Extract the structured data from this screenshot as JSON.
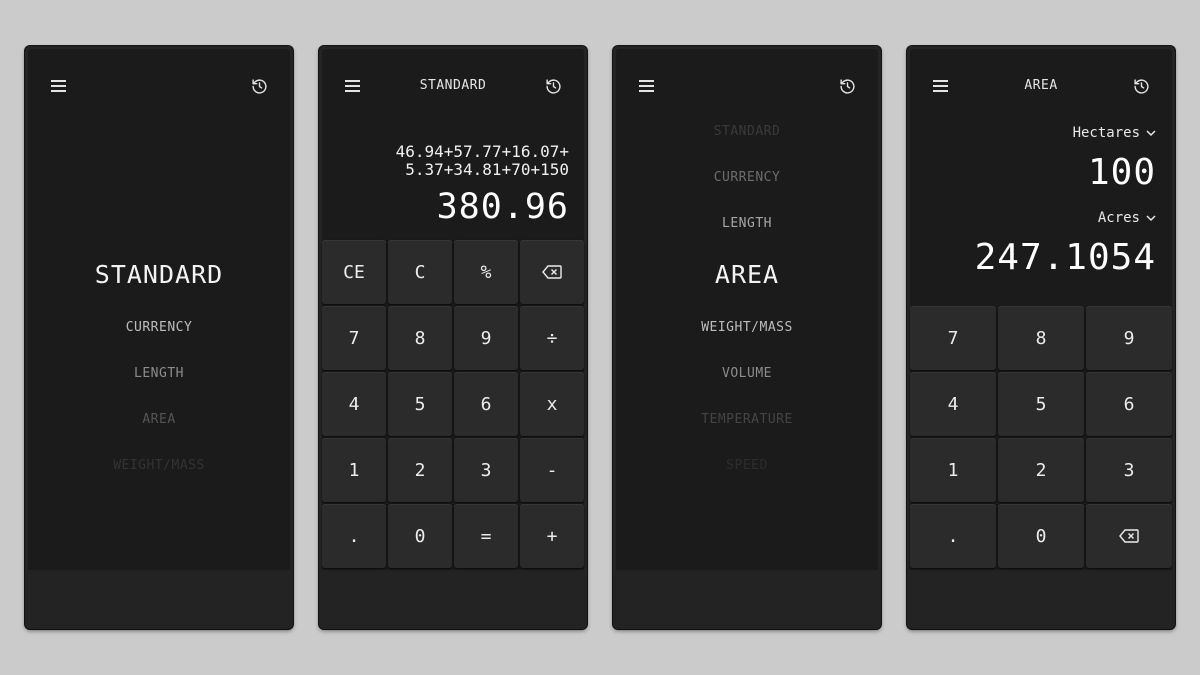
{
  "phone1": {
    "modes": [
      {
        "label": "STANDARD",
        "color": "#f3f3f3"
      },
      {
        "label": "CURRENCY",
        "color": "#bdbdbd"
      },
      {
        "label": "LENGTH",
        "color": "#8c8c8c"
      },
      {
        "label": "AREA",
        "color": "#555555"
      },
      {
        "label": "WEIGHT/MASS",
        "color": "#333333"
      }
    ]
  },
  "phone2": {
    "title": "STANDARD",
    "expression_line1": "46.94+57.77+16.07+",
    "expression_line2": "5.37+34.81+70+150",
    "result": "380.96",
    "keys": [
      {
        "label": "CE",
        "name": "clear-entry-key"
      },
      {
        "label": "C",
        "name": "clear-key"
      },
      {
        "label": "%",
        "name": "percent-key"
      },
      {
        "label": "",
        "name": "backspace-key",
        "icon": "backspace-icon"
      },
      {
        "label": "7",
        "name": "digit-7-key"
      },
      {
        "label": "8",
        "name": "digit-8-key"
      },
      {
        "label": "9",
        "name": "digit-9-key"
      },
      {
        "label": "÷",
        "name": "divide-key"
      },
      {
        "label": "4",
        "name": "digit-4-key"
      },
      {
        "label": "5",
        "name": "digit-5-key"
      },
      {
        "label": "6",
        "name": "digit-6-key"
      },
      {
        "label": "x",
        "name": "multiply-key"
      },
      {
        "label": "1",
        "name": "digit-1-key"
      },
      {
        "label": "2",
        "name": "digit-2-key"
      },
      {
        "label": "3",
        "name": "digit-3-key"
      },
      {
        "label": "-",
        "name": "subtract-key"
      },
      {
        "label": ".",
        "name": "decimal-key"
      },
      {
        "label": "0",
        "name": "digit-0-key"
      },
      {
        "label": "=",
        "name": "equals-key"
      },
      {
        "label": "+",
        "name": "add-key"
      }
    ]
  },
  "phone3": {
    "modes": [
      {
        "label": "STANDARD",
        "color": "#3a3a3a"
      },
      {
        "label": "CURRENCY",
        "color": "#6d6d6d"
      },
      {
        "label": "LENGTH",
        "color": "#a6a6a6"
      },
      {
        "label": "AREA",
        "color": "#f3f3f3"
      },
      {
        "label": "WEIGHT/MASS",
        "color": "#bdbdbd"
      },
      {
        "label": "VOLUME",
        "color": "#8c8c8c"
      },
      {
        "label": "TEMPERATURE",
        "color": "#444444"
      },
      {
        "label": "SPEED",
        "color": "#2d2d2d"
      }
    ]
  },
  "phone4": {
    "title": "AREA",
    "from_unit": "Hectares",
    "from_value": "100",
    "to_unit": "Acres",
    "to_value": "247.1054",
    "keys": [
      {
        "label": "7",
        "name": "digit-7-key"
      },
      {
        "label": "8",
        "name": "digit-8-key"
      },
      {
        "label": "9",
        "name": "digit-9-key"
      },
      {
        "label": "4",
        "name": "digit-4-key"
      },
      {
        "label": "5",
        "name": "digit-5-key"
      },
      {
        "label": "6",
        "name": "digit-6-key"
      },
      {
        "label": "1",
        "name": "digit-1-key"
      },
      {
        "label": "2",
        "name": "digit-2-key"
      },
      {
        "label": "3",
        "name": "digit-3-key"
      },
      {
        "label": ".",
        "name": "decimal-key"
      },
      {
        "label": "0",
        "name": "digit-0-key"
      },
      {
        "label": "",
        "name": "backspace-key",
        "icon": "backspace-icon"
      }
    ]
  },
  "icons": {
    "menu": "menu-icon",
    "history": "history-icon",
    "dropdown": "chevron-down-icon",
    "backspace": "backspace-icon"
  }
}
